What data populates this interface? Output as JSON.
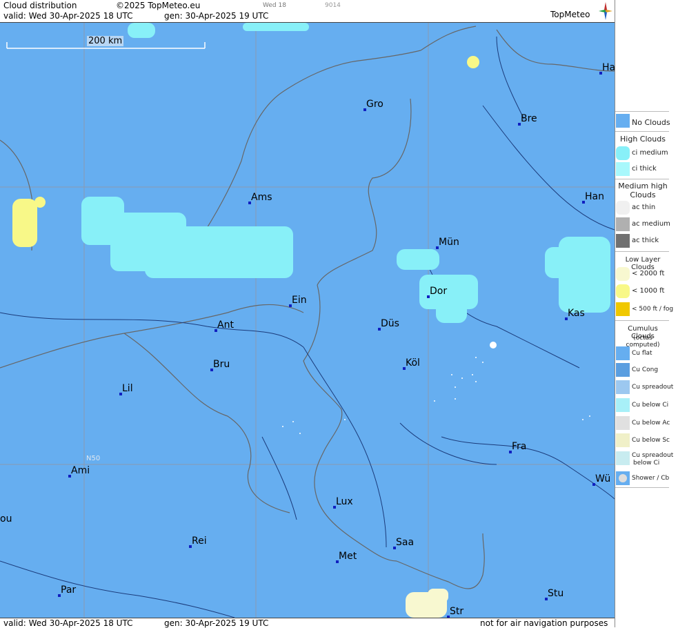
{
  "header": {
    "title": "Cloud distribution",
    "copyright": "©2025 TopMeteo.eu",
    "valid": "valid:  Wed  30-Apr-2025  18 UTC",
    "gen": "gen: 30-Apr-2025 19 UTC",
    "small_day": "Wed 18",
    "small_code": "9014",
    "logo": "TopMeteo"
  },
  "map": {
    "scale_label": "200 km",
    "lat_label": "N50",
    "colors": {
      "sea_land": "#66aef0",
      "ci_medium": "#88f0f8",
      "low_1000": "#f8f888",
      "low_2000": "#f8f8d0",
      "borders": "#666666",
      "rivers": "#1a3a7a",
      "grid": "#888888"
    },
    "cities": [
      {
        "name": "Gro"
      },
      {
        "name": "Bre"
      },
      {
        "name": "Ha"
      },
      {
        "name": "Ams"
      },
      {
        "name": "Han"
      },
      {
        "name": "Mün"
      },
      {
        "name": "Dor"
      },
      {
        "name": "Ein"
      },
      {
        "name": "Düs"
      },
      {
        "name": "Ant"
      },
      {
        "name": "Kas"
      },
      {
        "name": "Köl"
      },
      {
        "name": "Bru"
      },
      {
        "name": "Lil"
      },
      {
        "name": "Fra"
      },
      {
        "name": "Ami"
      },
      {
        "name": "Wü"
      },
      {
        "name": "Lux"
      },
      {
        "name": "ou"
      },
      {
        "name": "Rei"
      },
      {
        "name": "Saa"
      },
      {
        "name": "Met"
      },
      {
        "name": "Par"
      },
      {
        "name": "Stu"
      },
      {
        "name": "Str"
      }
    ]
  },
  "footer": {
    "valid": "valid:  Wed  30-Apr-2025  18 UTC",
    "gen": "gen: 30-Apr-2025 19 UTC",
    "note": "not for air navigation purposes"
  },
  "legend": {
    "no_clouds": "No Clouds",
    "high_title": "High Clouds",
    "ci_medium": "ci medium",
    "ci_thick": "ci thick",
    "medium_title": "Medium high Clouds",
    "ac_thin": "ac thin",
    "ac_medium": "ac medium",
    "ac_thick": "ac thick",
    "low_title": "Low Layer Clouds",
    "low_2000": "< 2000 ft",
    "low_1000": "< 1000 ft",
    "low_500": "< 500 ft / fog",
    "cu_title": "Cumulus Clouds",
    "cu_sub": "(octas computed)",
    "cu_flat": "Cu flat",
    "cu_cong": "Cu Cong",
    "cu_spread": "Cu spreadout",
    "cu_below_ci": "Cu below Ci",
    "cu_below_ac": "Cu below Ac",
    "cu_below_sc": "Cu below Sc",
    "cu_spread_ci_1": "Cu spreadout",
    "cu_spread_ci_2": "below Ci",
    "shower": "Shower / Cb"
  }
}
